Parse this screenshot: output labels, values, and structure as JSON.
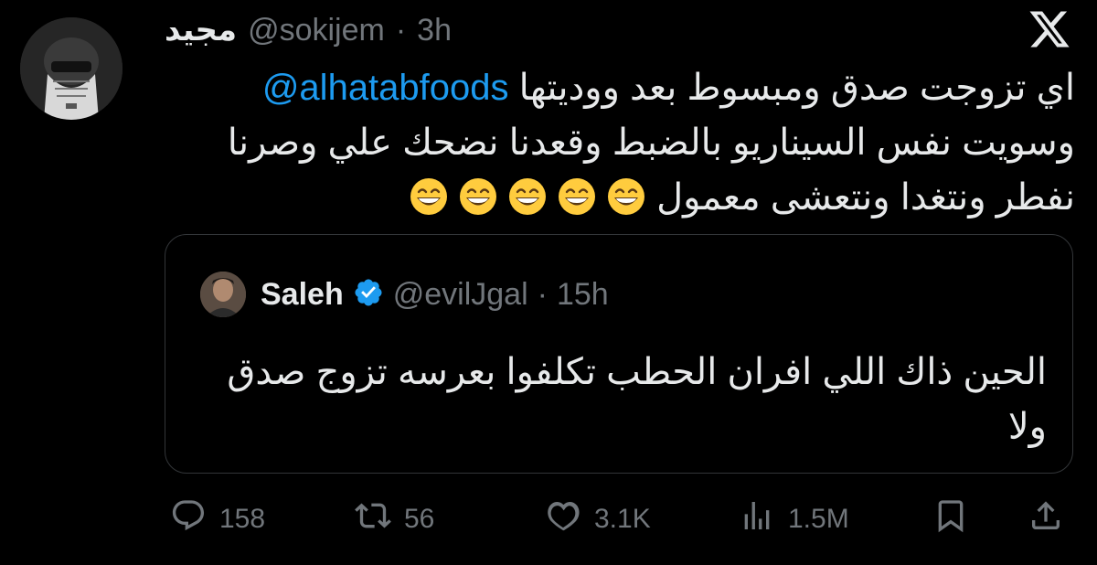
{
  "tweet": {
    "display_name": "مجيد",
    "handle": "@sokijem",
    "separator": "·",
    "time": "3h",
    "text_line1_prefix": "اي تزوجت صدق ومبسوط بعد ووديتها ",
    "mention": "@alhatabfoods",
    "text_line2": "وسويت نفس السيناريو بالضبط وقعدنا نضحك علي وصرنا",
    "text_line3": "نفطر ونتغدا ونتعشى معمول",
    "emoji_icon": "grinning-face-with-smiling-eyes-emoji",
    "emoji_count": 5
  },
  "quote": {
    "display_name": "Saleh",
    "handle": "@evilJgal",
    "separator": "·",
    "time": "15h",
    "text": "الحين ذاك اللي افران الحطب تكلفوا بعرسه تزوج صدق ولا"
  },
  "actions": {
    "replies": "158",
    "reposts": "56",
    "likes": "3.1K",
    "views": "1.5M"
  },
  "colors": {
    "background": "#000000",
    "text": "#e7e9ea",
    "muted": "#71767b",
    "link": "#1d9bf0",
    "border": "#333639"
  }
}
